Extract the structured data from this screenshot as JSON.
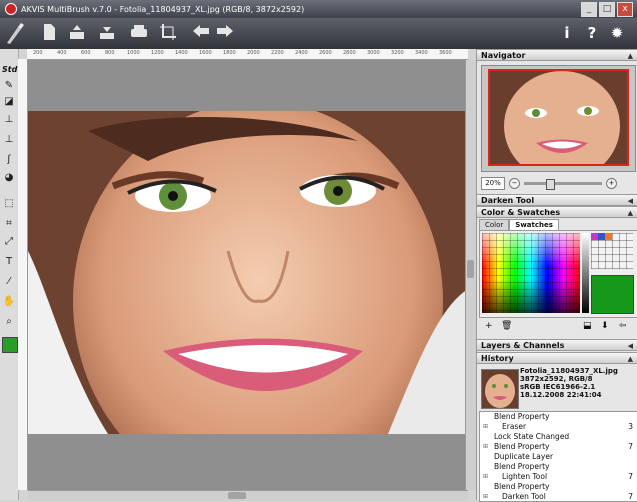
{
  "window": {
    "title": "AKVIS MultiBrush v.7.0 - Fotolia_11804937_XL.jpg (RGB/8, 3872x2592)"
  },
  "window_buttons": [
    "_",
    "□",
    "x"
  ],
  "toolbar": {
    "buttons": [
      "new-file",
      "open-file",
      "save-file",
      "print",
      "crop",
      "undo",
      "redo"
    ],
    "right_buttons": [
      "info",
      "help",
      "settings"
    ]
  },
  "tools": {
    "std_label": "Std"
  },
  "ruler": {
    "labels": [
      "200",
      "400",
      "600",
      "800",
      "1000",
      "1200",
      "1400",
      "1600",
      "1800",
      "2000",
      "2200",
      "2400",
      "2600",
      "2800",
      "3000",
      "3200",
      "3400",
      "3600"
    ]
  },
  "navigator": {
    "title": "Navigator",
    "zoom": "20%"
  },
  "panels": {
    "darken_tool": "Darken Tool",
    "color_swatches": "Color & Swatches",
    "layers_channels": "Layers & Channels",
    "history": "History"
  },
  "color_tabs": [
    "Color",
    "Swatches"
  ],
  "active_color": "#16991a",
  "history": {
    "file_name": "Fotolia_11804937_XL.jpg",
    "size": "3872x2592, RGB/8",
    "profile": "sRGB IEC61966-2.1",
    "date": "18.12.2008 22:41:04",
    "items": [
      {
        "label": "Blend Property",
        "count": "",
        "expander": false,
        "child": false
      },
      {
        "label": "Eraser",
        "count": "3",
        "expander": true,
        "child": true
      },
      {
        "label": "Lock State Changed",
        "count": "",
        "expander": false,
        "child": false
      },
      {
        "label": "Blend Property",
        "count": "7",
        "expander": true,
        "child": false
      },
      {
        "label": "Duplicate Layer",
        "count": "",
        "expander": false,
        "child": false
      },
      {
        "label": "Blend Property",
        "count": "",
        "expander": false,
        "child": false
      },
      {
        "label": "Lighten Tool",
        "count": "7",
        "expander": true,
        "child": true
      },
      {
        "label": "Blend Property",
        "count": "",
        "expander": false,
        "child": false
      },
      {
        "label": "Darken Tool",
        "count": "7",
        "expander": true,
        "child": true
      }
    ]
  }
}
